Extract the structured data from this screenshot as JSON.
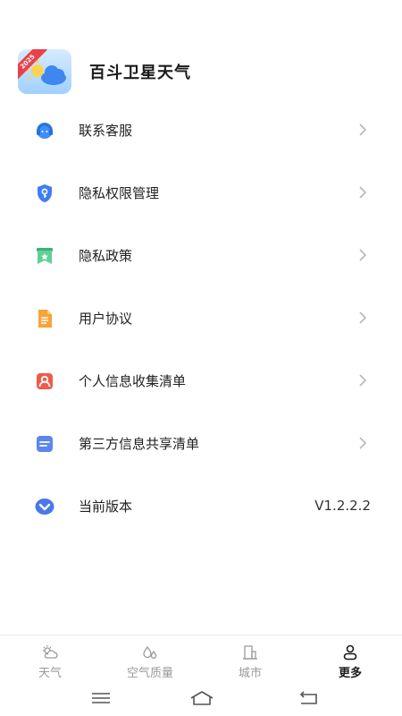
{
  "header": {
    "app_name": "百斗卫星天气",
    "logo_badge": "2025",
    "logo_icon": "sun-cloud-logo"
  },
  "menu": [
    {
      "label": "联系客服",
      "icon": "customer-service-icon"
    },
    {
      "label": "隐私权限管理",
      "icon": "shield-key-icon"
    },
    {
      "label": "隐私政策",
      "icon": "bookmark-star-icon"
    },
    {
      "label": "用户协议",
      "icon": "document-icon"
    },
    {
      "label": "个人信息收集清单",
      "icon": "person-card-icon"
    },
    {
      "label": "第三方信息共享清单",
      "icon": "share-document-icon"
    },
    {
      "label": "当前版本",
      "icon": "version-logo-icon",
      "value": "V1.2.2.2"
    }
  ],
  "tabs": [
    {
      "label": "天气",
      "icon": "weather-icon",
      "active": false
    },
    {
      "label": "空气质量",
      "icon": "air-quality-icon",
      "active": false
    },
    {
      "label": "城市",
      "icon": "city-icon",
      "active": false
    },
    {
      "label": "更多",
      "icon": "more-person-icon",
      "active": true
    }
  ],
  "colors": {
    "accent_blue": "#3f7df6",
    "orange": "#f7a43a",
    "red": "#ef5a4a",
    "green": "#4cc28a",
    "chevron": "#b8b8b8",
    "tab_inactive": "#9a9a9a"
  }
}
